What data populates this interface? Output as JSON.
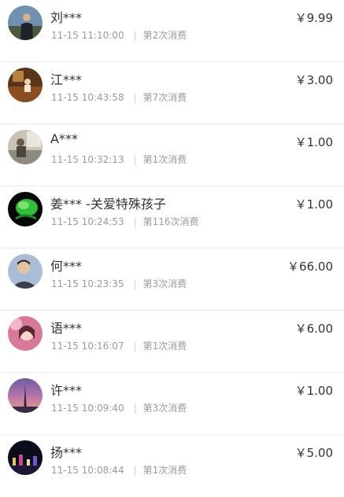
{
  "records": [
    {
      "name": "刘***",
      "time": "11-15 11:10:00",
      "count": "第2次消费",
      "amount": "￥9.99",
      "avatar_icon": "man-standing-avatar"
    },
    {
      "name": "江***",
      "time": "11-15 10:43:58",
      "count": "第7次消费",
      "amount": "￥3.00",
      "avatar_icon": "indoor-brown-avatar"
    },
    {
      "name": "A***",
      "time": "11-15 10:32:13",
      "count": "第1次消费",
      "amount": "￥1.00",
      "avatar_icon": "room-scene-avatar"
    },
    {
      "name": "姜*** -关爱特殊孩子",
      "time": "11-15 10:24:53",
      "count": "第116次消费",
      "amount": "￥1.00",
      "avatar_icon": "green-leaf-avatar"
    },
    {
      "name": "何***",
      "time": "11-15 10:23:35",
      "count": "第3次消费",
      "amount": "￥66.00",
      "avatar_icon": "man-portrait-avatar"
    },
    {
      "name": "语***",
      "time": "11-15 10:16:07",
      "count": "第1次消费",
      "amount": "￥6.00",
      "avatar_icon": "pink-portrait-avatar"
    },
    {
      "name": "许***",
      "time": "11-15 10:09:40",
      "count": "第3次消费",
      "amount": "￥1.00",
      "avatar_icon": "sunset-tower-avatar"
    },
    {
      "name": "扬***",
      "time": "11-15 10:08:44",
      "count": "第1次消费",
      "amount": "￥5.00",
      "avatar_icon": "night-city-avatar"
    }
  ]
}
